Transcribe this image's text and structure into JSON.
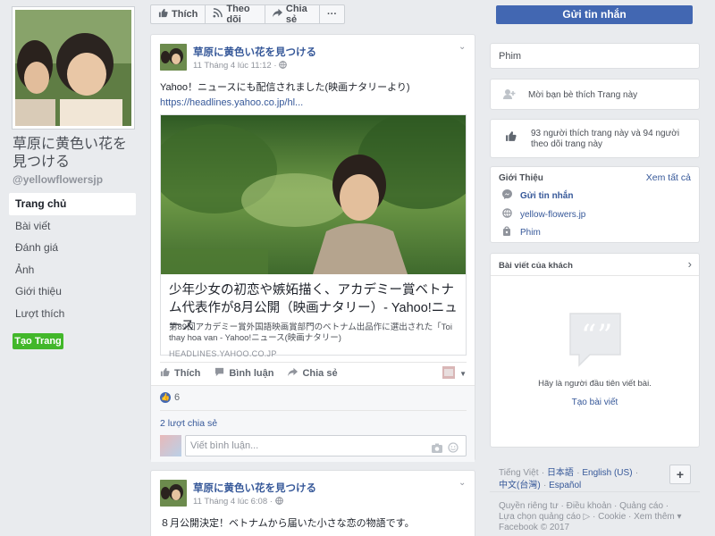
{
  "page": {
    "name": "草原に黄色い花を見つける",
    "handle": "@yellowflowersjp"
  },
  "nav": [
    {
      "label": "Trang chủ",
      "active": true
    },
    {
      "label": "Bài viết",
      "active": false
    },
    {
      "label": "Đánh giá",
      "active": false
    },
    {
      "label": "Ảnh",
      "active": false
    },
    {
      "label": "Giới thiệu",
      "active": false
    },
    {
      "label": "Lượt thích",
      "active": false
    }
  ],
  "create_page_label": "Tạo Trang",
  "actions": {
    "like": "Thích",
    "follow": "Theo dõi",
    "share": "Chia sẻ",
    "more": "···",
    "send_message": "Gửi tin nhắn"
  },
  "post1": {
    "author": "草原に黄色い花を見つける",
    "time": "11 Tháng 4 lúc 11:12 ·",
    "text": "Yahoo！ニュースにも配信されました(映画ナタリーより)",
    "link": "https://headlines.yahoo.co.jp/hl...",
    "preview": {
      "title": "少年少女の初恋や嫉妬描く、アカデミー賞ベトナム代表作が8月公開（映画ナタリー）- Yahoo!ニュース",
      "description": "第89回アカデミー賞外国語映画賞部門のベトナム出品作に選出された「Toi thay hoa van - Yahoo!ニュース(映画ナタリー)",
      "domain": "HEADLINES.YAHOO.CO.JP"
    },
    "like_label": "Thích",
    "comment_label": "Bình luận",
    "share_label": "Chia sẻ",
    "like_count": "6",
    "shares": "2 lượt chia sẻ",
    "comment_placeholder": "Viết bình luận..."
  },
  "post2": {
    "author": "草原に黄色い花を見つける",
    "time": "11 Tháng 4 lúc 6:08 ·",
    "text": "８月公開決定！ベトナムから届いた小さな恋の物語です。"
  },
  "right": {
    "category": "Phim",
    "invite": "Mời bạn bè thích Trang này",
    "likes_text": "93 người thích trang này và 94 người theo dõi trang này",
    "about_title": "Giới Thiệu",
    "see_all": "Xem tất cả",
    "about_message": "Gửi tin nhắn",
    "about_site": "yellow-flowers.jp",
    "about_category": "Phim",
    "visitor_title": "Bài viết của khách",
    "visitor_empty": "Hãy là người đầu tiên viết bài.",
    "visitor_create": "Tạo bài viết",
    "languages": [
      "Tiếng Việt",
      "日本語",
      "English (US)",
      "中文(台灣)",
      "Español"
    ],
    "footer1": "Quyền riêng tư · Điều khoản · Quảng cáo ·",
    "footer2": "Lựa chọn quảng cáo ▷ · Cookie · Xem thêm ▾",
    "footer3": "Facebook © 2017"
  },
  "colors": {
    "brand": "#4267b2",
    "link": "#365899",
    "create": "#42b72a",
    "background": "#e9ebee"
  }
}
